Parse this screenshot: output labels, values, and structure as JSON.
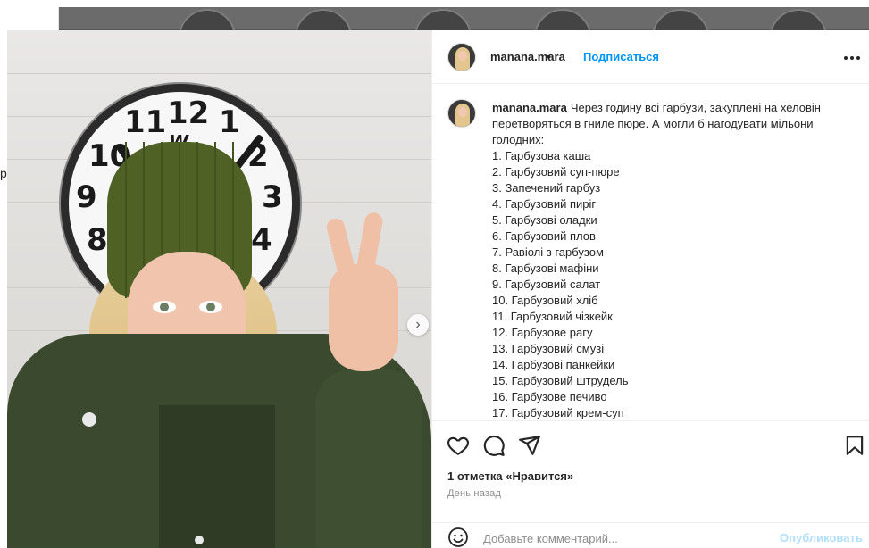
{
  "backdrop": {
    "edge_letter": "р"
  },
  "post": {
    "username": "manana.mara",
    "follow_label": "Подписаться",
    "separator": "•",
    "more_label": "•••",
    "caption": {
      "username": "manana.mara",
      "intro": "Через годину всі гарбузи, закуплені на хеловін перетворяться в гниле пюре. А могли б нагодувати мільони голодних:",
      "items": [
        "1. Гарбузова каша",
        "2. Гарбузовий суп-пюре",
        "3. Запечений гарбуз",
        "4. Гарбузовий пиріг",
        "5. Гарбузові оладки",
        "6. Гарбузовий плов",
        "7. Равіолі з гарбузом",
        "8. Гарбузові мафіни",
        "9. Гарбузовий салат",
        "10. Гарбузовий хліб",
        "11. Гарбузовий чізкейк",
        "12. Гарбузове рагу",
        "13. Гарбузовий смузі",
        "14. Гарбузові панкейки",
        "15. Гарбузовий штрудель",
        "16. Гарбузове печиво",
        "17. Гарбузовий крем-суп"
      ]
    },
    "likes_text": "1 отметка «Нравится»",
    "time_text": "День назад",
    "comment_placeholder": "Добавьте комментарий...",
    "publish_label": "Опубликовать",
    "carousel": {
      "slides": 3,
      "active": 1
    },
    "clock_numbers": [
      "12",
      "11",
      "10",
      "9",
      "8",
      "1",
      "2",
      "3",
      "4"
    ],
    "clock_brand": "W"
  },
  "colors": {
    "link_blue": "#0095f6",
    "publish_disabled": "#b2dffc",
    "muted_text": "#8e8e8e",
    "divider": "#efefef"
  },
  "icons": [
    "heart-icon",
    "comment-icon",
    "share-icon",
    "bookmark-icon",
    "emoji-icon",
    "chevron-right-icon",
    "more-icon"
  ]
}
